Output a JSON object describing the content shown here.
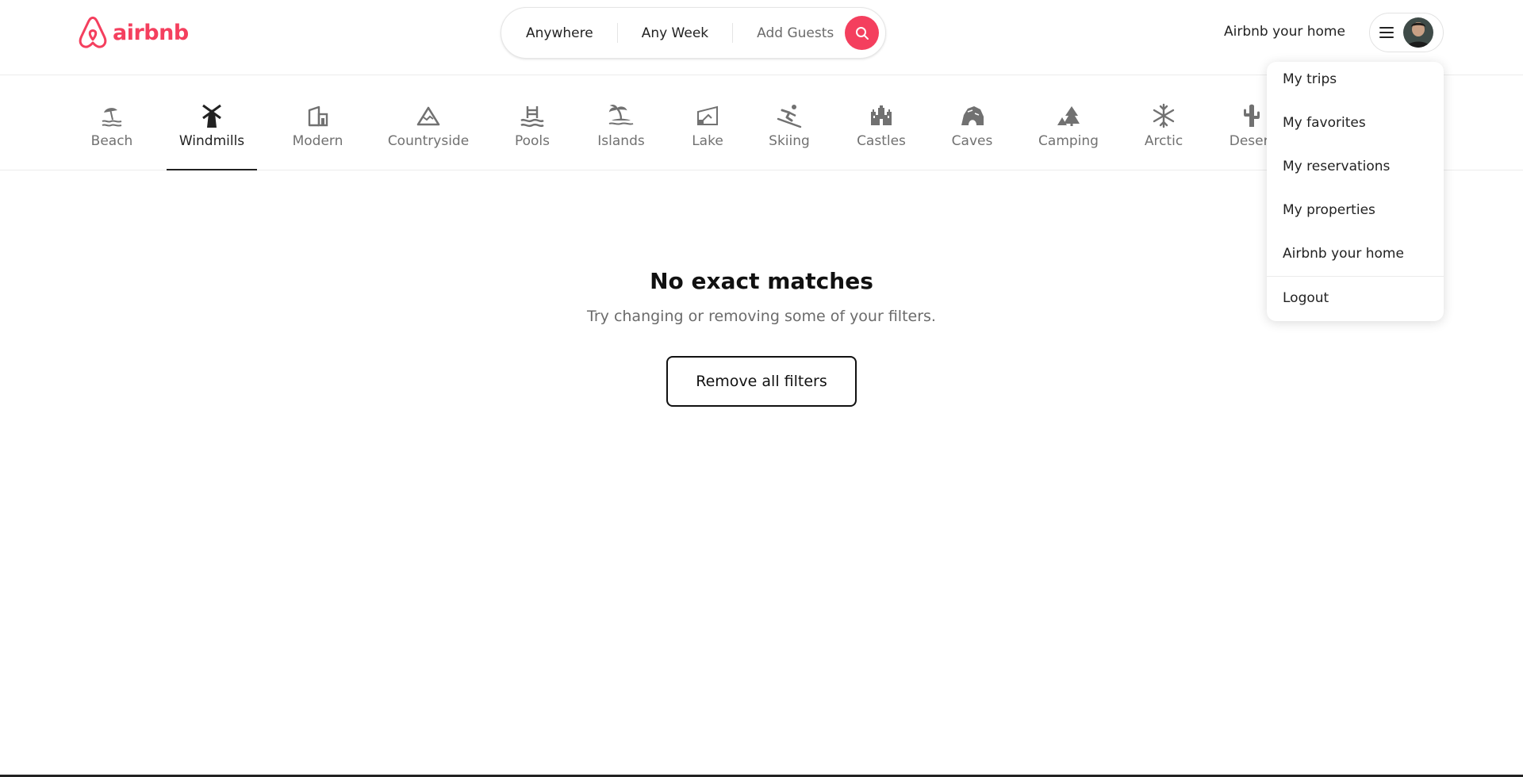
{
  "brand": {
    "name": "airbnb",
    "color": "#F43F5E"
  },
  "search": {
    "location": "Anywhere",
    "week": "Any Week",
    "guests": "Add Guests"
  },
  "header": {
    "host_link": "Airbnb your home"
  },
  "categories": [
    {
      "label": "Beach",
      "icon": "beach-icon"
    },
    {
      "label": "Windmills",
      "icon": "windmill-icon",
      "active": true
    },
    {
      "label": "Modern",
      "icon": "modern-icon"
    },
    {
      "label": "Countryside",
      "icon": "mountain-icon"
    },
    {
      "label": "Pools",
      "icon": "pool-icon"
    },
    {
      "label": "Islands",
      "icon": "island-icon"
    },
    {
      "label": "Lake",
      "icon": "lake-icon"
    },
    {
      "label": "Skiing",
      "icon": "skiing-icon"
    },
    {
      "label": "Castles",
      "icon": "castle-icon"
    },
    {
      "label": "Caves",
      "icon": "cave-icon"
    },
    {
      "label": "Camping",
      "icon": "camping-icon"
    },
    {
      "label": "Arctic",
      "icon": "snowflake-icon"
    },
    {
      "label": "Desert",
      "icon": "cactus-icon"
    }
  ],
  "empty_state": {
    "title": "No exact matches",
    "subtitle": "Try changing or removing some of your filters.",
    "button": "Remove all filters"
  },
  "user_menu": {
    "items": [
      "My trips",
      "My favorites",
      "My reservations",
      "My properties",
      "Airbnb your home"
    ],
    "logout": "Logout"
  }
}
